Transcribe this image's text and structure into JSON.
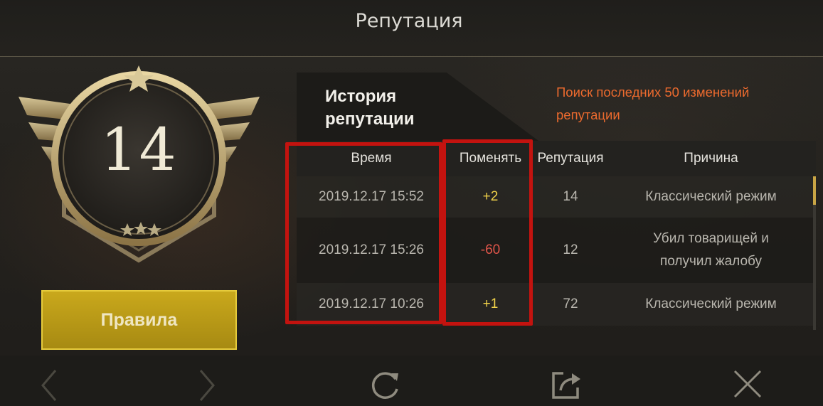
{
  "header": {
    "title": "Репутация"
  },
  "badge": {
    "value": "14"
  },
  "rules_button": {
    "label": "Правила"
  },
  "history": {
    "title_line1": "История",
    "title_line2": "репутации",
    "search_note": "Поиск последних 50 изменений репутации"
  },
  "table": {
    "headers": {
      "time": "Время",
      "change": "Поменять",
      "reputation": "Репутация",
      "reason": "Причина"
    },
    "rows": [
      {
        "time": "2019.12.17 15:52",
        "change": "+2",
        "reputation": "14",
        "reason_line1": "Классический режим",
        "reason_line2": ""
      },
      {
        "time": "2019.12.17 15:26",
        "change": "-60",
        "reputation": "12",
        "reason_line1": "Убил товарищей и",
        "reason_line2": "получил жалобу"
      },
      {
        "time": "2019.12.17 10:26",
        "change": "+1",
        "reputation": "72",
        "reason_line1": "Классический режим",
        "reason_line2": ""
      }
    ]
  },
  "colors": {
    "positive": "#f2d34a",
    "negative": "#e0554a",
    "accent_orange": "#ec6a2e",
    "highlight_red": "#c3130f",
    "gold": "#c9a81c"
  },
  "icons": {
    "prev": "chevron-left-icon",
    "next": "chevron-right-icon",
    "refresh": "refresh-icon",
    "share": "share-icon",
    "close": "close-icon"
  }
}
